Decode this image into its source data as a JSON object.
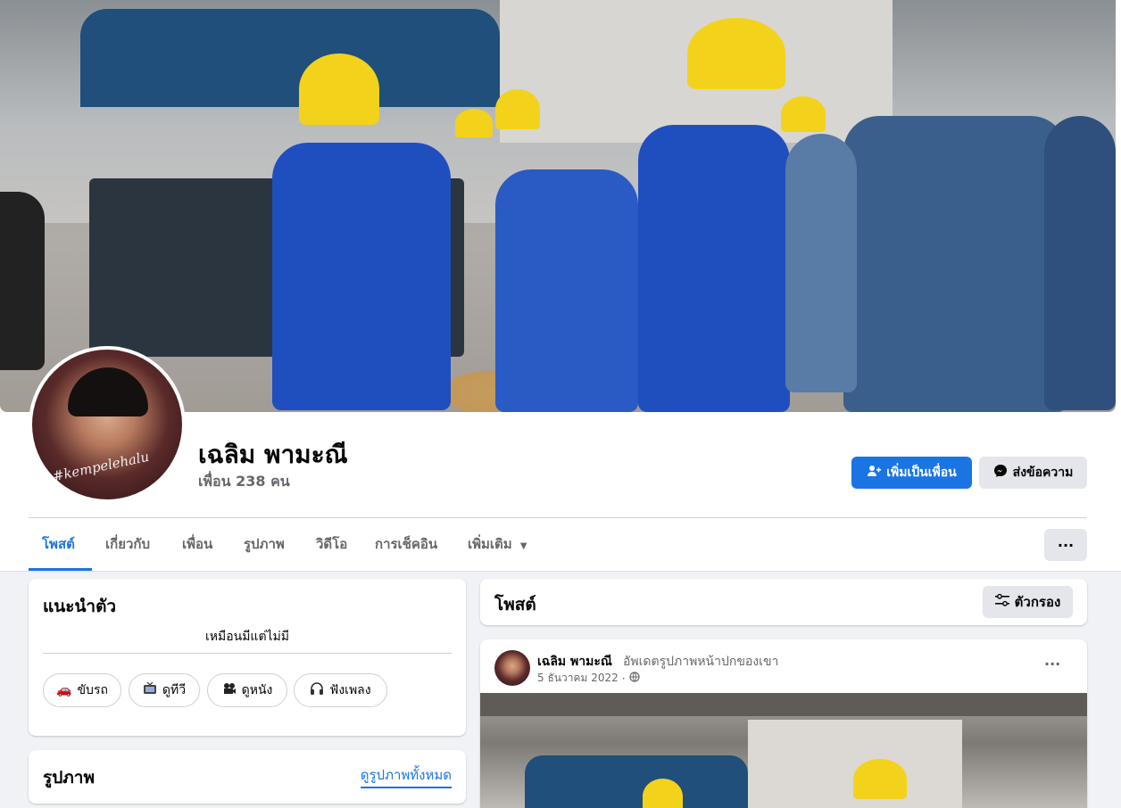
{
  "profile": {
    "name": "เฉลิม พามะณี",
    "friends": "เพื่อน 238 คน",
    "avatar_tag": "#kempelehalu"
  },
  "actions": {
    "add_friend": "เพิ่มเป็นเพื่อน",
    "message": "ส่งข้อความ",
    "more": "···"
  },
  "tabs": [
    {
      "label": "โพสต์",
      "active": true
    },
    {
      "label": "เกี่ยวกับ",
      "active": false
    },
    {
      "label": "เพื่อน",
      "active": false
    },
    {
      "label": "รูปภาพ",
      "active": false
    },
    {
      "label": "วิดีโอ",
      "active": false
    },
    {
      "label": "การเช็คอิน",
      "active": false
    },
    {
      "label": "เพิ่มเติม",
      "active": false
    }
  ],
  "intro": {
    "title": "แนะนำตัว",
    "bio": "เหมือนมีแต่ไม่มี",
    "hobbies": [
      {
        "icon": "car-icon",
        "label": "ขับรถ"
      },
      {
        "icon": "tv-icon",
        "label": "ดูทีวี"
      },
      {
        "icon": "film-icon",
        "label": "ดูหนัง"
      },
      {
        "icon": "headphones-icon",
        "label": "ฟังเพลง"
      }
    ]
  },
  "photos": {
    "title": "รูปภาพ",
    "see_all": "ดูรูปภาพทั้งหมด"
  },
  "posts": {
    "title": "โพสต์",
    "filter": "ตัวกรอง"
  },
  "post": {
    "author": "เฉลิม พามะณี",
    "action": "อัพเดตรูปภาพหน้าปกของเขา",
    "date": "5 ธันวาคม 2022",
    "dot": "·",
    "more": "···"
  },
  "colors": {
    "accent": "#1b74e4",
    "background": "#f0f2f5",
    "secondary_button": "#e4e6eb",
    "muted_text": "#65676b"
  }
}
